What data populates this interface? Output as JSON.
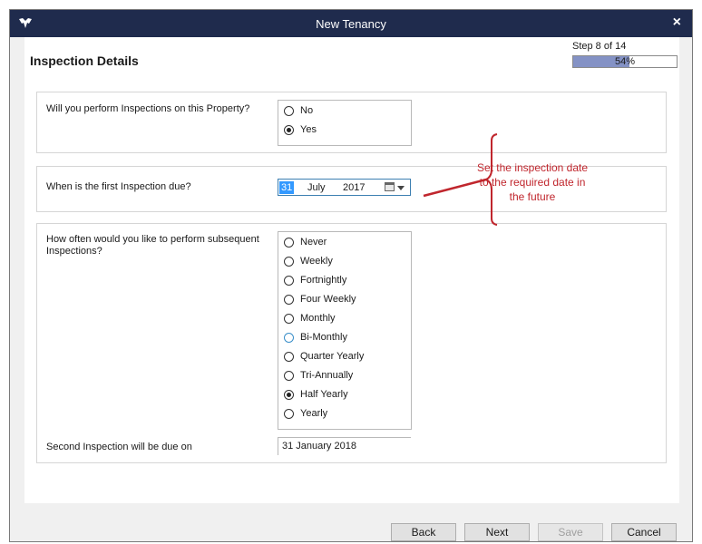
{
  "window": {
    "title": "New Tenancy",
    "close_glyph": "×"
  },
  "header": {
    "heading": "Inspection Details",
    "step_text": "Step 8 of 14",
    "progress_text": "54%",
    "progress_value": 0.54,
    "progress_color": "#8492c5"
  },
  "q1": {
    "label": "Will you perform Inspections on this Property?",
    "options": [
      "No",
      "Yes"
    ],
    "selected": "Yes"
  },
  "q2": {
    "label": "When is the first Inspection due?",
    "date": {
      "day": "31",
      "month": "July",
      "year": "2017"
    }
  },
  "q3": {
    "label": "How often would you like to perform subsequent Inspections?",
    "options": [
      "Never",
      "Weekly",
      "Fortnightly",
      "Four Weekly",
      "Monthly",
      "Bi-Monthly",
      "Quarter Yearly",
      "Tri-Annually",
      "Half Yearly",
      "Yearly"
    ],
    "selected": "Half Yearly",
    "second_label": "Second Inspection will be due on",
    "second_value": "31 January 2018"
  },
  "annotation": {
    "text": "Set the inspection date to the required date in the future",
    "color": "#c0262d"
  },
  "buttons": {
    "back": "Back",
    "next": "Next",
    "save": "Save",
    "cancel": "Cancel"
  },
  "colors": {
    "titlebar": "#1f2b4d",
    "selection": "#3399ff"
  }
}
